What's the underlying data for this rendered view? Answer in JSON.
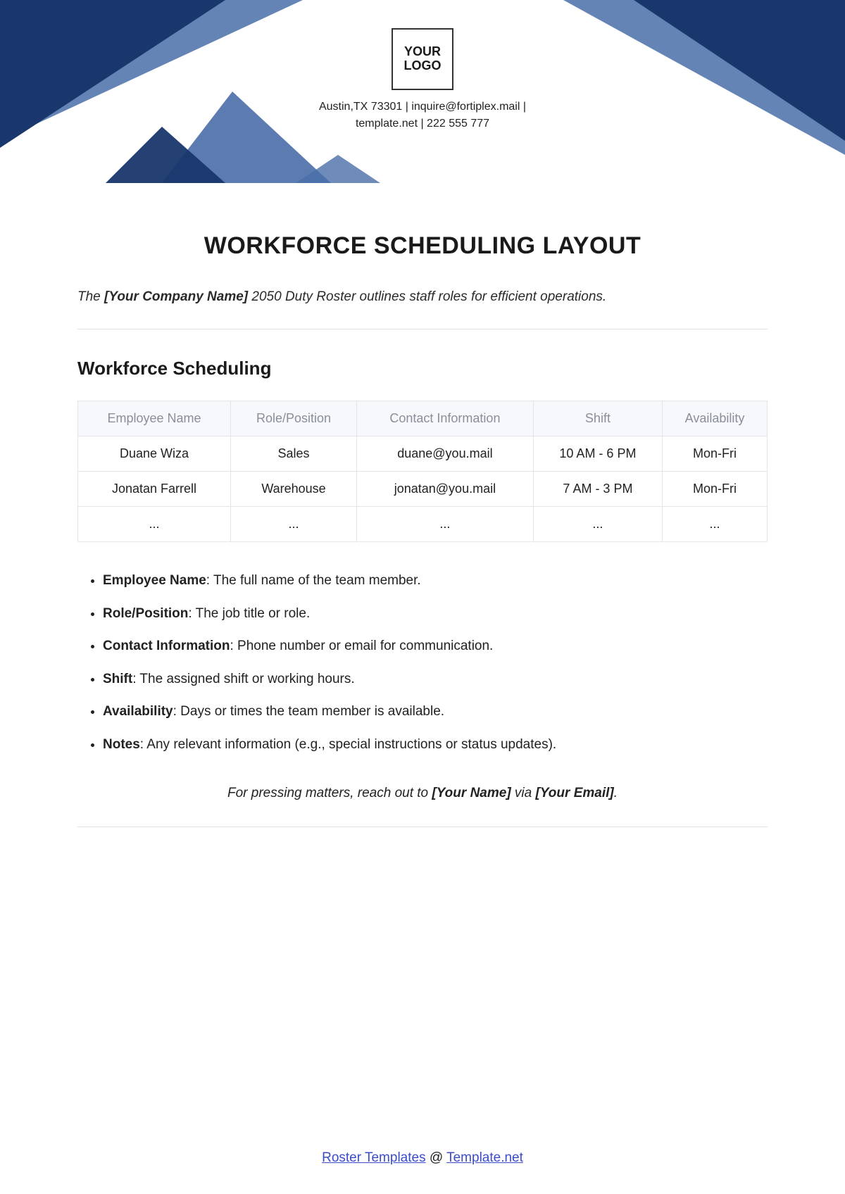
{
  "logo": {
    "line1": "YOUR",
    "line2": "LOGO"
  },
  "contact": {
    "line1": "Austin,TX 73301 | inquire@fortiplex.mail |",
    "line2": "template.net | 222 555 777"
  },
  "title": "WORKFORCE SCHEDULING LAYOUT",
  "intro": {
    "prefix": "The ",
    "bold": "[Your Company Name]",
    "suffix": " 2050 Duty Roster outlines staff roles for efficient operations."
  },
  "section_heading": "Workforce Scheduling",
  "table": {
    "headers": [
      "Employee Name",
      "Role/Position",
      "Contact Information",
      "Shift",
      "Availability"
    ],
    "rows": [
      [
        "Duane Wiza",
        "Sales",
        "duane@you.mail",
        "10 AM - 6 PM",
        "Mon-Fri"
      ],
      [
        "Jonatan Farrell",
        "Warehouse",
        "jonatan@you.mail",
        "7 AM - 3 PM",
        "Mon-Fri"
      ],
      [
        "...",
        "...",
        "...",
        "...",
        "..."
      ]
    ]
  },
  "definitions": [
    {
      "term": "Employee Name",
      "desc": ": The full name of the team member."
    },
    {
      "term": "Role/Position",
      "desc": ": The job title or role."
    },
    {
      "term": "Contact Information",
      "desc": ": Phone number or email for communication."
    },
    {
      "term": "Shift",
      "desc": ": The assigned shift or working hours."
    },
    {
      "term": "Availability",
      "desc": ": Days or times the team member is available."
    },
    {
      "term": "Notes",
      "desc": ": Any relevant information (e.g., special instructions or status updates)."
    }
  ],
  "closing": {
    "prefix": "For pressing matters, reach out to ",
    "bold1": "[Your Name]",
    "mid": " via ",
    "bold2": "[Your Email]",
    "end": "."
  },
  "footer": {
    "link1": "Roster Templates",
    "at": " @ ",
    "link2": "Template.net"
  }
}
